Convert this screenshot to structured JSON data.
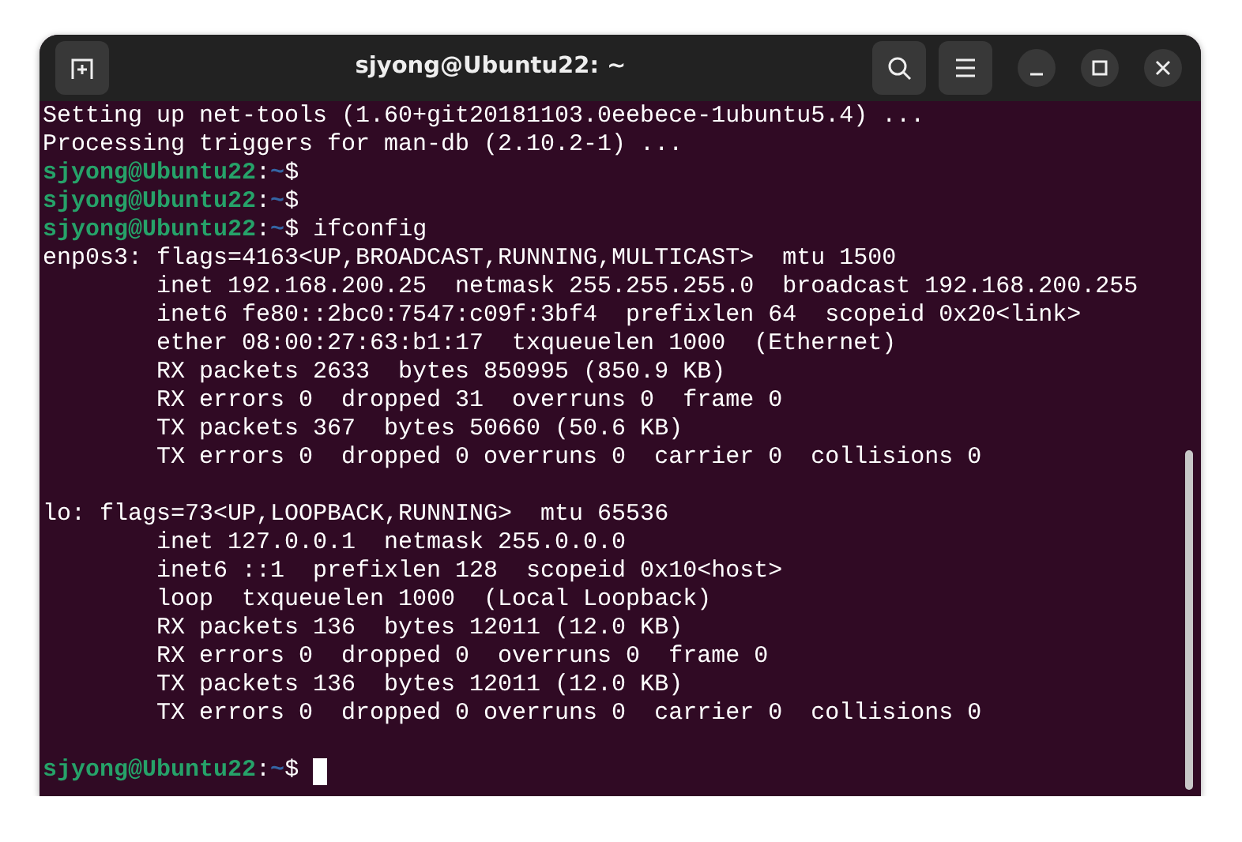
{
  "window": {
    "title": "sjyong@Ubuntu22: ~"
  },
  "lines": [
    {
      "kind": "output",
      "text": "Setting up net-tools (1.60+git20181103.0eebece-1ubuntu5.4) ..."
    },
    {
      "kind": "output",
      "text": "Processing triggers for man-db (2.10.2-1) ..."
    },
    {
      "kind": "prompt",
      "user_host": "sjyong@Ubuntu22",
      "separator": ":",
      "path": "~",
      "symbol": "$"
    },
    {
      "kind": "prompt",
      "user_host": "sjyong@Ubuntu22",
      "separator": ":",
      "path": "~",
      "symbol": "$"
    },
    {
      "kind": "prompt",
      "user_host": "sjyong@Ubuntu22",
      "separator": ":",
      "path": "~",
      "symbol": "$",
      "command": "ifconfig"
    },
    {
      "kind": "output",
      "text": "enp0s3: flags=4163<UP,BROADCAST,RUNNING,MULTICAST>  mtu 1500"
    },
    {
      "kind": "output",
      "text": "        inet 192.168.200.25  netmask 255.255.255.0  broadcast 192.168.200.255"
    },
    {
      "kind": "output",
      "text": "        inet6 fe80::2bc0:7547:c09f:3bf4  prefixlen 64  scopeid 0x20<link>"
    },
    {
      "kind": "output",
      "text": "        ether 08:00:27:63:b1:17  txqueuelen 1000  (Ethernet)"
    },
    {
      "kind": "output",
      "text": "        RX packets 2633  bytes 850995 (850.9 KB)"
    },
    {
      "kind": "output",
      "text": "        RX errors 0  dropped 31  overruns 0  frame 0"
    },
    {
      "kind": "output",
      "text": "        TX packets 367  bytes 50660 (50.6 KB)"
    },
    {
      "kind": "output",
      "text": "        TX errors 0  dropped 0 overruns 0  carrier 0  collisions 0"
    },
    {
      "kind": "blank"
    },
    {
      "kind": "output",
      "text": "lo: flags=73<UP,LOOPBACK,RUNNING>  mtu 65536"
    },
    {
      "kind": "output",
      "text": "        inet 127.0.0.1  netmask 255.0.0.0"
    },
    {
      "kind": "output",
      "text": "        inet6 ::1  prefixlen 128  scopeid 0x10<host>"
    },
    {
      "kind": "output",
      "text": "        loop  txqueuelen 1000  (Local Loopback)"
    },
    {
      "kind": "output",
      "text": "        RX packets 136  bytes 12011 (12.0 KB)"
    },
    {
      "kind": "output",
      "text": "        RX errors 0  dropped 0  overruns 0  frame 0"
    },
    {
      "kind": "output",
      "text": "        TX packets 136  bytes 12011 (12.0 KB)"
    },
    {
      "kind": "output",
      "text": "        TX errors 0  dropped 0 overruns 0  carrier 0  collisions 0"
    },
    {
      "kind": "blank"
    },
    {
      "kind": "prompt",
      "user_host": "sjyong@Ubuntu22",
      "separator": ":",
      "path": "~",
      "symbol": "$",
      "cursor": true
    }
  ]
}
